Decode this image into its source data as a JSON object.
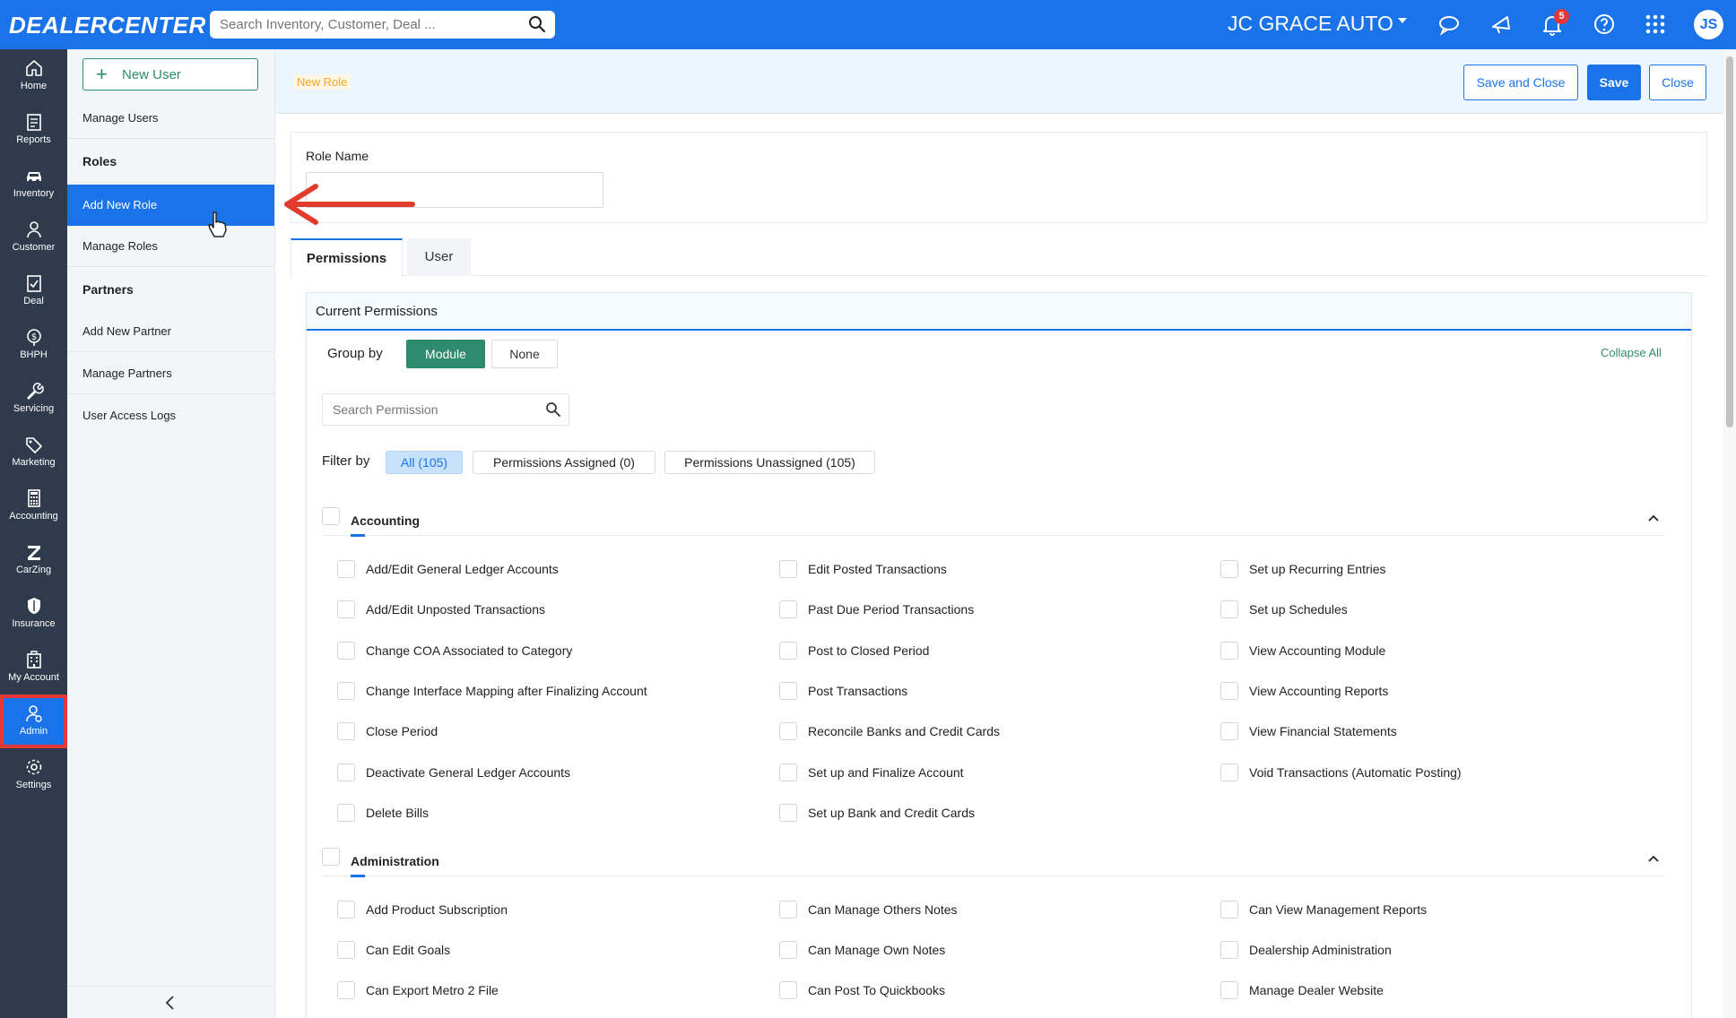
{
  "app": {
    "logo": "DEALERCENTER",
    "search_placeholder": "Search Inventory, Customer, Deal ...",
    "dealer_name": "JC GRACE AUTO",
    "notification_count": "5",
    "user_initials": "JS"
  },
  "leftnav": [
    {
      "label": "Home",
      "icon": "home-icon"
    },
    {
      "label": "Reports",
      "icon": "reports-icon"
    },
    {
      "label": "Inventory",
      "icon": "car-icon"
    },
    {
      "label": "Customer",
      "icon": "person-icon"
    },
    {
      "label": "Deal",
      "icon": "deal-icon"
    },
    {
      "label": "BHPH",
      "icon": "dollar-icon"
    },
    {
      "label": "Servicing",
      "icon": "wrench-icon"
    },
    {
      "label": "Marketing",
      "icon": "tag-icon"
    },
    {
      "label": "Accounting",
      "icon": "calculator-icon"
    },
    {
      "label": "CarZing",
      "icon": "carzing-icon"
    },
    {
      "label": "Insurance",
      "icon": "shield-icon"
    },
    {
      "label": "My Account",
      "icon": "building-icon"
    },
    {
      "label": "Admin",
      "icon": "admin-icon"
    },
    {
      "label": "Settings",
      "icon": "gear-icon"
    }
  ],
  "submenu": {
    "new_user": "New User",
    "manage_users": "Manage Users",
    "roles_heading": "Roles",
    "add_new_role": "Add New Role",
    "manage_roles": "Manage Roles",
    "partners_heading": "Partners",
    "add_new_partner": "Add New Partner",
    "manage_partners": "Manage Partners",
    "user_access_logs": "User Access Logs"
  },
  "header": {
    "breadcrumb": "New Role",
    "save_and_close": "Save and Close",
    "save": "Save",
    "close": "Close"
  },
  "role": {
    "label": "Role Name",
    "value": ""
  },
  "tabs": [
    "Permissions",
    "User"
  ],
  "permissions": {
    "panel_title": "Current Permissions",
    "group_by_label": "Group by",
    "group_by_options": [
      "Module",
      "None"
    ],
    "group_by_selected": "Module",
    "collapse_all": "Collapse All",
    "search_placeholder": "Search Permission",
    "filter_by_label": "Filter by",
    "filters": [
      "All (105)",
      "Permissions Assigned (0)",
      "Permissions Unassigned (105)"
    ],
    "filter_selected": "All (105)"
  },
  "sections": [
    {
      "title": "Accounting",
      "columns": [
        [
          "Add/Edit General Ledger Accounts",
          "Add/Edit Unposted Transactions",
          "Change COA Associated to Category",
          "Change Interface Mapping after Finalizing Account",
          "Close Period",
          "Deactivate General Ledger Accounts",
          "Delete Bills"
        ],
        [
          "Edit Posted Transactions",
          "Past Due Period Transactions",
          "Post to Closed Period",
          "Post Transactions",
          "Reconcile Banks and Credit Cards",
          "Set up and Finalize Account",
          "Set up Bank and Credit Cards"
        ],
        [
          "Set up Recurring Entries",
          "Set up Schedules",
          "View Accounting Module",
          "View Accounting Reports",
          "View Financial Statements",
          "Void Transactions (Automatic Posting)"
        ]
      ]
    },
    {
      "title": "Administration",
      "columns": [
        [
          "Add Product Subscription",
          "Can Edit Goals",
          "Can Export Metro 2 File"
        ],
        [
          "Can Manage Others Notes",
          "Can Manage Own Notes",
          "Can Post To Quickbooks"
        ],
        [
          "Can View Management Reports",
          "Dealership Administration",
          "Manage Dealer Website"
        ]
      ]
    }
  ]
}
